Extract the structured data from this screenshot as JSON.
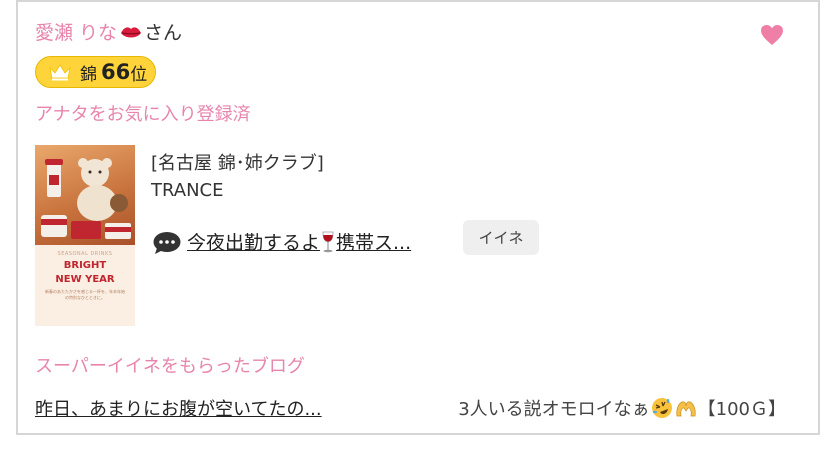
{
  "profile": {
    "name": "愛瀬 りな",
    "name_emoji": "kiss-lips-icon",
    "honorific": "さん",
    "favorite_icon": "heart-icon",
    "accent_color": "#e785ad"
  },
  "rank": {
    "icon": "crown-icon",
    "area": "錦",
    "number": "66",
    "suffix": "位",
    "badge_color": "#ffd43b"
  },
  "favorite_status": "アナタをお気に入り登録済",
  "post": {
    "thumbnail": {
      "small_text": "SEASONAL DRINKS",
      "title_line1": "BRIGHT",
      "title_line2": "NEW YEAR",
      "caption": "新春のあたたかさを感じる一杯を、年末年始の特別なひとときに。"
    },
    "shop_area": "[名古屋 錦･姉クラブ]",
    "shop_name": "TRANCE",
    "chat_icon": "speech-bubble-icon",
    "message_part1": "今夜出勤するよ",
    "message_emoji": "wine-glass-icon",
    "message_part2": "携帯ス...",
    "like_label": "イイネ"
  },
  "super_like": {
    "title": "スーパーイイネをもらったブログ",
    "blog_title": "昨日、あまりにお腹が空いてたの...",
    "comment": "3人いる説オモロイなぁ",
    "comment_emojis": [
      "rolling-laughing-icon",
      "heart-hands-icon"
    ],
    "points": "【100Ｇ】"
  }
}
